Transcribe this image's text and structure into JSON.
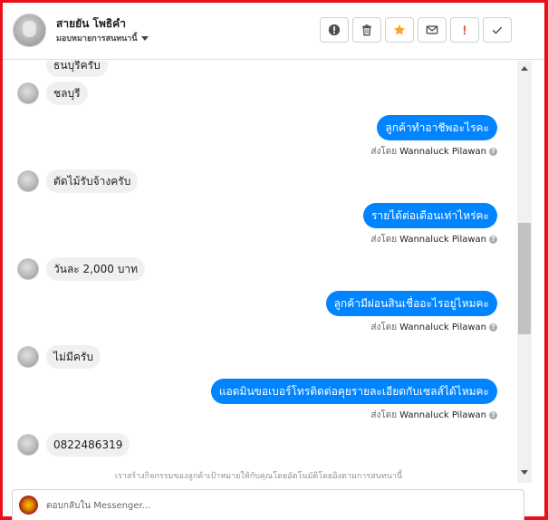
{
  "header": {
    "contact_name": "สายยัน โพธิคำ",
    "assign_label": "มอบหมายการสนทนานี้"
  },
  "toolbar": [
    {
      "name": "spam-button",
      "icon": "alert-circle-icon"
    },
    {
      "name": "delete-button",
      "icon": "trash-icon"
    },
    {
      "name": "star-button",
      "icon": "star-icon"
    },
    {
      "name": "mark-unread-button",
      "icon": "envelope-icon"
    },
    {
      "name": "follow-up-button",
      "icon": "exclamation-icon",
      "text": "!"
    },
    {
      "name": "mark-done-button",
      "icon": "check-icon"
    }
  ],
  "messages": [
    {
      "dir": "in",
      "text": "ธนบุรีครับ"
    },
    {
      "dir": "in",
      "text": "ชลบุรี"
    },
    {
      "dir": "out",
      "text": "ลูกค้าทำอาชีพอะไรคะ",
      "sent_prefix": "ส่งโดย",
      "sender": "Wannaluck Pilawan"
    },
    {
      "dir": "in",
      "text": "ตัดไม้รับจ้างครับ"
    },
    {
      "dir": "out",
      "text": "รายได้ต่อเดือนเท่าไหร่คะ",
      "sent_prefix": "ส่งโดย",
      "sender": "Wannaluck Pilawan"
    },
    {
      "dir": "in",
      "text": "วันละ 2,000 บาท"
    },
    {
      "dir": "out",
      "text": "ลูกค้ามีผ่อนสินเชื่ออะไรอยู่ไหมคะ",
      "sent_prefix": "ส่งโดย",
      "sender": "Wannaluck Pilawan"
    },
    {
      "dir": "in",
      "text": "ไม่มีครับ"
    },
    {
      "dir": "out",
      "text": "แอดมินขอเบอร์โทรติดต่อคุยรายละเอียดกับเซลส์ได้ไหมคะ",
      "sent_prefix": "ส่งโดย",
      "sender": "Wannaluck Pilawan"
    },
    {
      "dir": "in",
      "text": "0822486319"
    }
  ],
  "notice": "เราสร้างกิจกรรมของลูกค้าเป้าหมายให้กับคุณโดยอัตโนมัติโดยอิงตามการสนทนานี้",
  "composer": {
    "placeholder": "ตอบกลับใน Messenger..."
  },
  "colors": {
    "outgoing_bubble": "#0084ff",
    "incoming_bubble": "#f1f0f0",
    "frame_border": "#e8111b",
    "star": "#f5a623"
  }
}
